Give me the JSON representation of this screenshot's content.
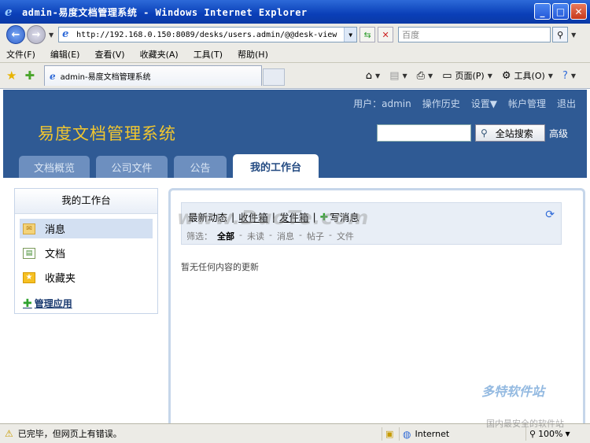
{
  "browser": {
    "window_title": "admin-易度文档管理系统 - Windows Internet Explorer",
    "address": "http://192.168.0.150:8089/desks/users.admin/@@desk-view",
    "search_placeholder": "百度",
    "menu": [
      "文件(F)",
      "编辑(E)",
      "查看(V)",
      "收藏夹(A)",
      "工具(T)",
      "帮助(H)"
    ],
    "tab_title": "admin-易度文档管理系统",
    "toolbar": {
      "page_label": "页面(P)",
      "tools_label": "工具(O)"
    },
    "status_text": "已完毕，但网页上有错误。",
    "zone": "Internet",
    "zoom": "100%"
  },
  "site": {
    "usernav": {
      "user_label": "用户：",
      "user_name": "admin",
      "history": "操作历史",
      "settings": "设置▼",
      "account": "帐户管理",
      "logout": "退出"
    },
    "title": "易度文档管理系统",
    "search_button": "全站搜索",
    "advanced": "高级",
    "nav_tabs": [
      "文档概览",
      "公司文件",
      "公告",
      "我的工作台"
    ],
    "active_tab": "我的工作台",
    "left_panel": {
      "heading": "我的工作台",
      "items": [
        "消息",
        "文档",
        "收藏夹"
      ],
      "manage": "管理应用"
    },
    "main": {
      "tabs": [
        "最新动态",
        "收件箱",
        "发件箱",
        "写消息"
      ],
      "filter_label": "筛选：",
      "filters": [
        "全部",
        "未读",
        "消息",
        "帖子",
        "文件"
      ],
      "active_filter": "全部",
      "empty_message": "暂无任何内容的更新"
    }
  },
  "watermarks": {
    "center": "www.DuoTe.com",
    "corner": "多特软件站",
    "corner_sub": "国内最安全的软件站"
  }
}
